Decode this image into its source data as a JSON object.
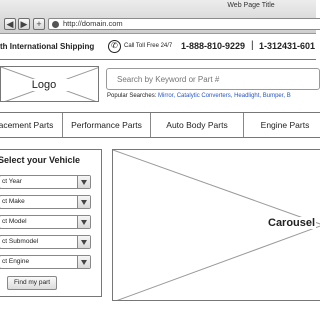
{
  "browser": {
    "window_title": "Web Page Title",
    "url": "http://domain.com",
    "back_glyph": "◀",
    "forward_glyph": "▶",
    "add_glyph": "+"
  },
  "topbar": {
    "shipping_text": "th International Shipping",
    "call_label": "Call Toll Free 24/7",
    "phone_primary": "1-888-810-9229",
    "separator": "|",
    "phone_secondary": "1-312431-601"
  },
  "header": {
    "logo_label": "Logo",
    "search_placeholder": "Search by Keyword or Part #",
    "popular_label": "Popular Searches:",
    "popular_links": "Mirror, Catalytic Converters, Headlight, Bumper, B"
  },
  "categories": [
    "acement Parts",
    "Performance Parts",
    "Auto Body Parts",
    "Engine Parts"
  ],
  "vehicle": {
    "title": "Select your Vehicle",
    "selects": [
      "ct Year",
      "ct Make",
      "ct Model",
      "ct Submodel",
      "ct Engine"
    ],
    "find_button": "Find my part"
  },
  "carousel": {
    "label": "Carousel"
  },
  "icons": {
    "phone": "phone-icon",
    "globe": "globe-icon"
  }
}
